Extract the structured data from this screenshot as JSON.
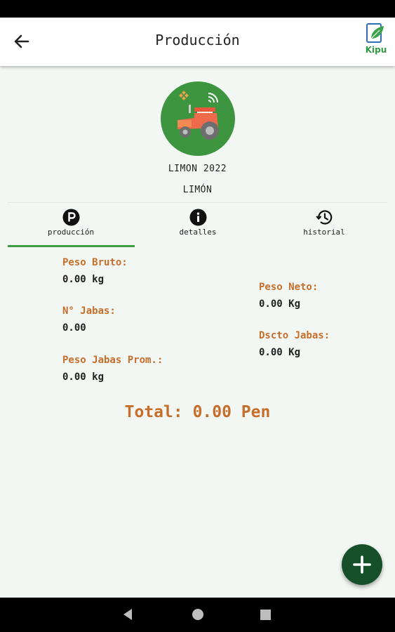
{
  "app_bar": {
    "title": "Producción",
    "logo_text": "Kipu"
  },
  "crop": {
    "name": "LIMON 2022",
    "variety": "LIMÓN"
  },
  "tabs": [
    {
      "label": "producción",
      "icon": "p-circle-icon",
      "active": true
    },
    {
      "label": "detalles",
      "icon": "info-icon",
      "active": false
    },
    {
      "label": "historial",
      "icon": "history-icon",
      "active": false
    }
  ],
  "production": {
    "peso_bruto": {
      "label": "Peso Bruto:",
      "value": "0.00 kg"
    },
    "n_jabas": {
      "label": "N° Jabas:",
      "value": "0.00"
    },
    "peso_jabas_prom": {
      "label": "Peso Jabas Prom.:",
      "value": "0.00 kg"
    },
    "peso_neto": {
      "label": "Peso Neto:",
      "value": "0.00 Kg"
    },
    "dscto_jabas": {
      "label": "Dscto Jabas:",
      "value": "0.00 Kg"
    },
    "total": "Total: 0.00 Pen"
  },
  "colors": {
    "accent_orange": "#c66e2a",
    "brand_green": "#3d9540",
    "fab_green": "#15502a",
    "background": "#f3f7f4"
  }
}
